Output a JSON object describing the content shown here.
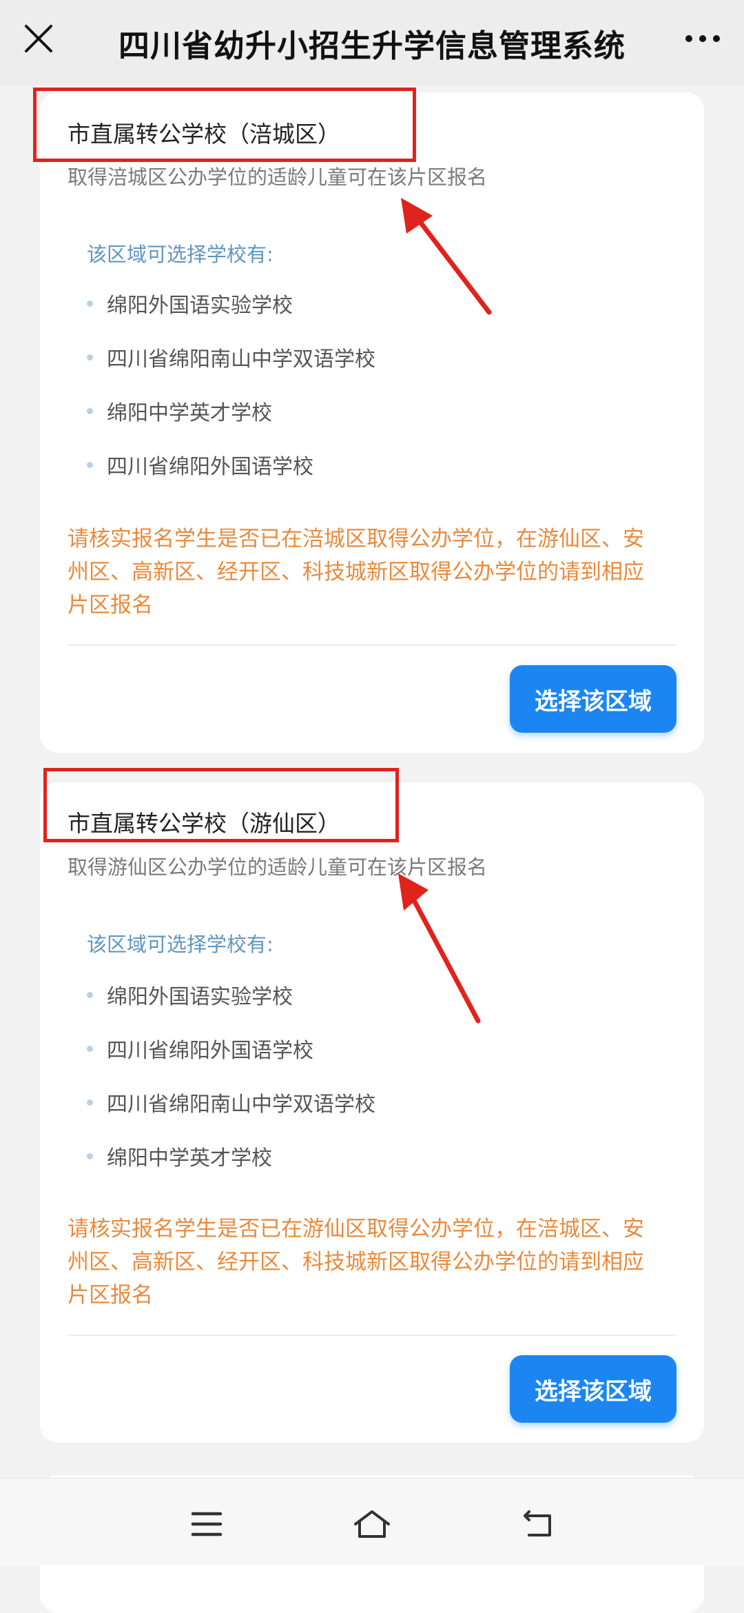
{
  "header": {
    "title": "四川省幼升小招生升学信息管理系统"
  },
  "cards": [
    {
      "title": "市直属转公学校（涪城区）",
      "subtitle": "取得涪城区公办学位的适龄儿童可在该片区报名",
      "schools_heading": "该区域可选择学校有:",
      "schools": [
        "绵阳外国语实验学校",
        "四川省绵阳南山中学双语学校",
        "绵阳中学英才学校",
        "四川省绵阳外国语学校"
      ],
      "notice_lines": [
        "请核实报名学生是否已在涪城区取得公办学位，在游仙区、安",
        "州区、高新区、经开区、科技城新区取得公办学位的请到相应",
        "片区报名"
      ],
      "button": "选择该区域"
    },
    {
      "title": "市直属转公学校（游仙区）",
      "subtitle": "取得游仙区公办学位的适龄儿童可在该片区报名",
      "schools_heading": "该区域可选择学校有:",
      "schools": [
        "绵阳外国语实验学校",
        "四川省绵阳外国语学校",
        "四川省绵阳南山中学双语学校",
        "绵阳中学英才学校"
      ],
      "notice_lines": [
        "请核实报名学生是否已在游仙区取得公办学位，在涪城区、安",
        "州区、高新区、经开区、科技城新区取得公办学位的请到相应",
        "片区报名"
      ],
      "button": "选择该区域"
    }
  ],
  "icons": {
    "close": "close-icon",
    "more": "more-icon",
    "menu": "menu-icon",
    "home": "home-icon",
    "back": "back-icon"
  },
  "colors": {
    "accent_button": "#1b86f2",
    "notice": "#e98a3c",
    "school_heading": "#5f96be",
    "annotation_red": "#e0231c"
  }
}
